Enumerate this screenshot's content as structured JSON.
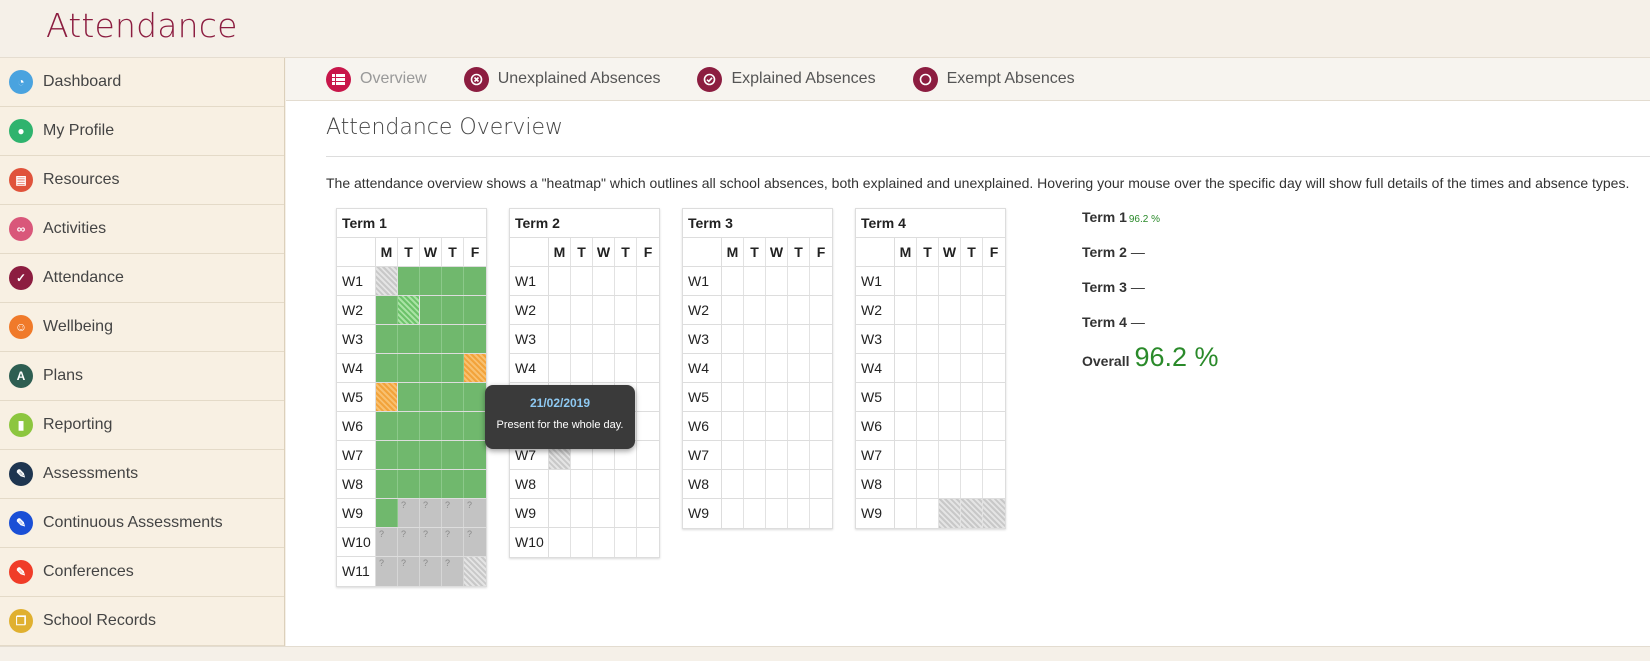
{
  "app": {
    "title": "Attendance"
  },
  "sidebar": {
    "items": [
      {
        "label": "Dashboard",
        "icon": "dashboard-icon",
        "color": "#4aa3df",
        "glyph": "◔"
      },
      {
        "label": "My Profile",
        "icon": "user-icon",
        "color": "#2fb36e",
        "glyph": "●"
      },
      {
        "label": "Resources",
        "icon": "book-icon",
        "color": "#e0533b",
        "glyph": "▤"
      },
      {
        "label": "Activities",
        "icon": "bicycle-icon",
        "color": "#d9577a",
        "glyph": "∞"
      },
      {
        "label": "Attendance",
        "icon": "check-circle-icon",
        "color": "#8c1d40",
        "glyph": "✓"
      },
      {
        "label": "Wellbeing",
        "icon": "smile-icon",
        "color": "#f07a2a",
        "glyph": "☺"
      },
      {
        "label": "Plans",
        "icon": "road-icon",
        "color": "#2e5e52",
        "glyph": "A"
      },
      {
        "label": "Reporting",
        "icon": "bar-chart-icon",
        "color": "#8cc63f",
        "glyph": "▮"
      },
      {
        "label": "Assessments",
        "icon": "pencil-icon",
        "color": "#1e3550",
        "glyph": "✎"
      },
      {
        "label": "Continuous Assessments",
        "icon": "pencil-icon",
        "color": "#1a4fd6",
        "glyph": "✎"
      },
      {
        "label": "Conferences",
        "icon": "pencil-icon",
        "color": "#f03c28",
        "glyph": "✎"
      },
      {
        "label": "School Records",
        "icon": "copy-icon",
        "color": "#e0b030",
        "glyph": "❐"
      }
    ]
  },
  "tabs": [
    {
      "label": "Overview",
      "icon": "list-icon",
      "active": true
    },
    {
      "label": "Unexplained Absences",
      "icon": "x-circle-icon",
      "active": false
    },
    {
      "label": "Explained Absences",
      "icon": "check-circle-icon",
      "active": false
    },
    {
      "label": "Exempt Absences",
      "icon": "circle-icon",
      "active": false
    }
  ],
  "page": {
    "title": "Attendance Overview",
    "description": "The attendance overview shows a \"heatmap\" which outlines all school absences, both explained and unexplained. Hovering your mouse over the specific day will show full details of the times and absence types."
  },
  "days": [
    "M",
    "T",
    "W",
    "T",
    "F"
  ],
  "legend": {
    "p": "present-whole-day",
    "u": "unknown",
    "h": "no-school-hatched",
    "o": "partial-absence-orange",
    "g": "partial-present-hatched-green",
    "e": "empty"
  },
  "terms": [
    {
      "name": "Term 1",
      "weeks": [
        "W1",
        "W2",
        "W3",
        "W4",
        "W5",
        "W6",
        "W7",
        "W8",
        "W9",
        "W10",
        "W11"
      ],
      "cells": [
        [
          "h",
          "p",
          "p",
          "p",
          "p"
        ],
        [
          "p",
          "g",
          "p",
          "p",
          "p"
        ],
        [
          "p",
          "p",
          "p",
          "p",
          "p"
        ],
        [
          "p",
          "p",
          "p",
          "p",
          "o"
        ],
        [
          "o",
          "p",
          "p",
          "p",
          "p"
        ],
        [
          "p",
          "p",
          "p",
          "p",
          "p"
        ],
        [
          "p",
          "p",
          "p",
          "p",
          "p"
        ],
        [
          "p",
          "p",
          "p",
          "p",
          "p"
        ],
        [
          "p",
          "u",
          "u",
          "u",
          "u"
        ],
        [
          "u",
          "u",
          "u",
          "u",
          "u"
        ],
        [
          "u",
          "u",
          "u",
          "u",
          "h"
        ]
      ]
    },
    {
      "name": "Term 2",
      "weeks": [
        "W1",
        "W2",
        "W3",
        "W4",
        "W5",
        "W6",
        "W7",
        "W8",
        "W9",
        "W10"
      ],
      "cells": [
        [
          "e",
          "e",
          "e",
          "e",
          "e"
        ],
        [
          "e",
          "e",
          "e",
          "e",
          "e"
        ],
        [
          "e",
          "e",
          "e",
          "e",
          "e"
        ],
        [
          "e",
          "e",
          "e",
          "e",
          "e"
        ],
        [
          "e",
          "e",
          "e",
          "e",
          "e"
        ],
        [
          "e",
          "e",
          "e",
          "e",
          "e"
        ],
        [
          "h",
          "e",
          "e",
          "e",
          "e"
        ],
        [
          "e",
          "e",
          "e",
          "e",
          "e"
        ],
        [
          "e",
          "e",
          "e",
          "e",
          "e"
        ],
        [
          "e",
          "e",
          "e",
          "e",
          "e"
        ]
      ]
    },
    {
      "name": "Term 3",
      "weeks": [
        "W1",
        "W2",
        "W3",
        "W4",
        "W5",
        "W6",
        "W7",
        "W8",
        "W9"
      ],
      "cells": [
        [
          "e",
          "e",
          "e",
          "e",
          "e"
        ],
        [
          "e",
          "e",
          "e",
          "e",
          "e"
        ],
        [
          "e",
          "e",
          "e",
          "e",
          "e"
        ],
        [
          "e",
          "e",
          "e",
          "e",
          "e"
        ],
        [
          "e",
          "e",
          "e",
          "e",
          "e"
        ],
        [
          "e",
          "e",
          "e",
          "e",
          "e"
        ],
        [
          "e",
          "e",
          "e",
          "e",
          "e"
        ],
        [
          "e",
          "e",
          "e",
          "e",
          "e"
        ],
        [
          "e",
          "e",
          "e",
          "e",
          "e"
        ]
      ]
    },
    {
      "name": "Term 4",
      "weeks": [
        "W1",
        "W2",
        "W3",
        "W4",
        "W5",
        "W6",
        "W7",
        "W8",
        "W9"
      ],
      "cells": [
        [
          "e",
          "e",
          "e",
          "e",
          "e"
        ],
        [
          "e",
          "e",
          "e",
          "e",
          "e"
        ],
        [
          "e",
          "e",
          "e",
          "e",
          "e"
        ],
        [
          "e",
          "e",
          "e",
          "e",
          "e"
        ],
        [
          "e",
          "e",
          "e",
          "e",
          "e"
        ],
        [
          "e",
          "e",
          "e",
          "e",
          "e"
        ],
        [
          "e",
          "e",
          "e",
          "e",
          "e"
        ],
        [
          "e",
          "e",
          "e",
          "e",
          "e"
        ],
        [
          "e",
          "e",
          "h",
          "h",
          "h"
        ]
      ]
    }
  ],
  "summary": {
    "rows": [
      {
        "label": "Term 1",
        "value": "",
        "pct": "96.2 %"
      },
      {
        "label": "Term 2",
        "value": "—",
        "pct": ""
      },
      {
        "label": "Term 3",
        "value": "—",
        "pct": ""
      },
      {
        "label": "Term 4",
        "value": "—",
        "pct": ""
      }
    ],
    "overall_label": "Overall",
    "overall_value": "96.2 %"
  },
  "tooltip": {
    "date": "21/02/2019",
    "text": "Present for the whole day."
  }
}
